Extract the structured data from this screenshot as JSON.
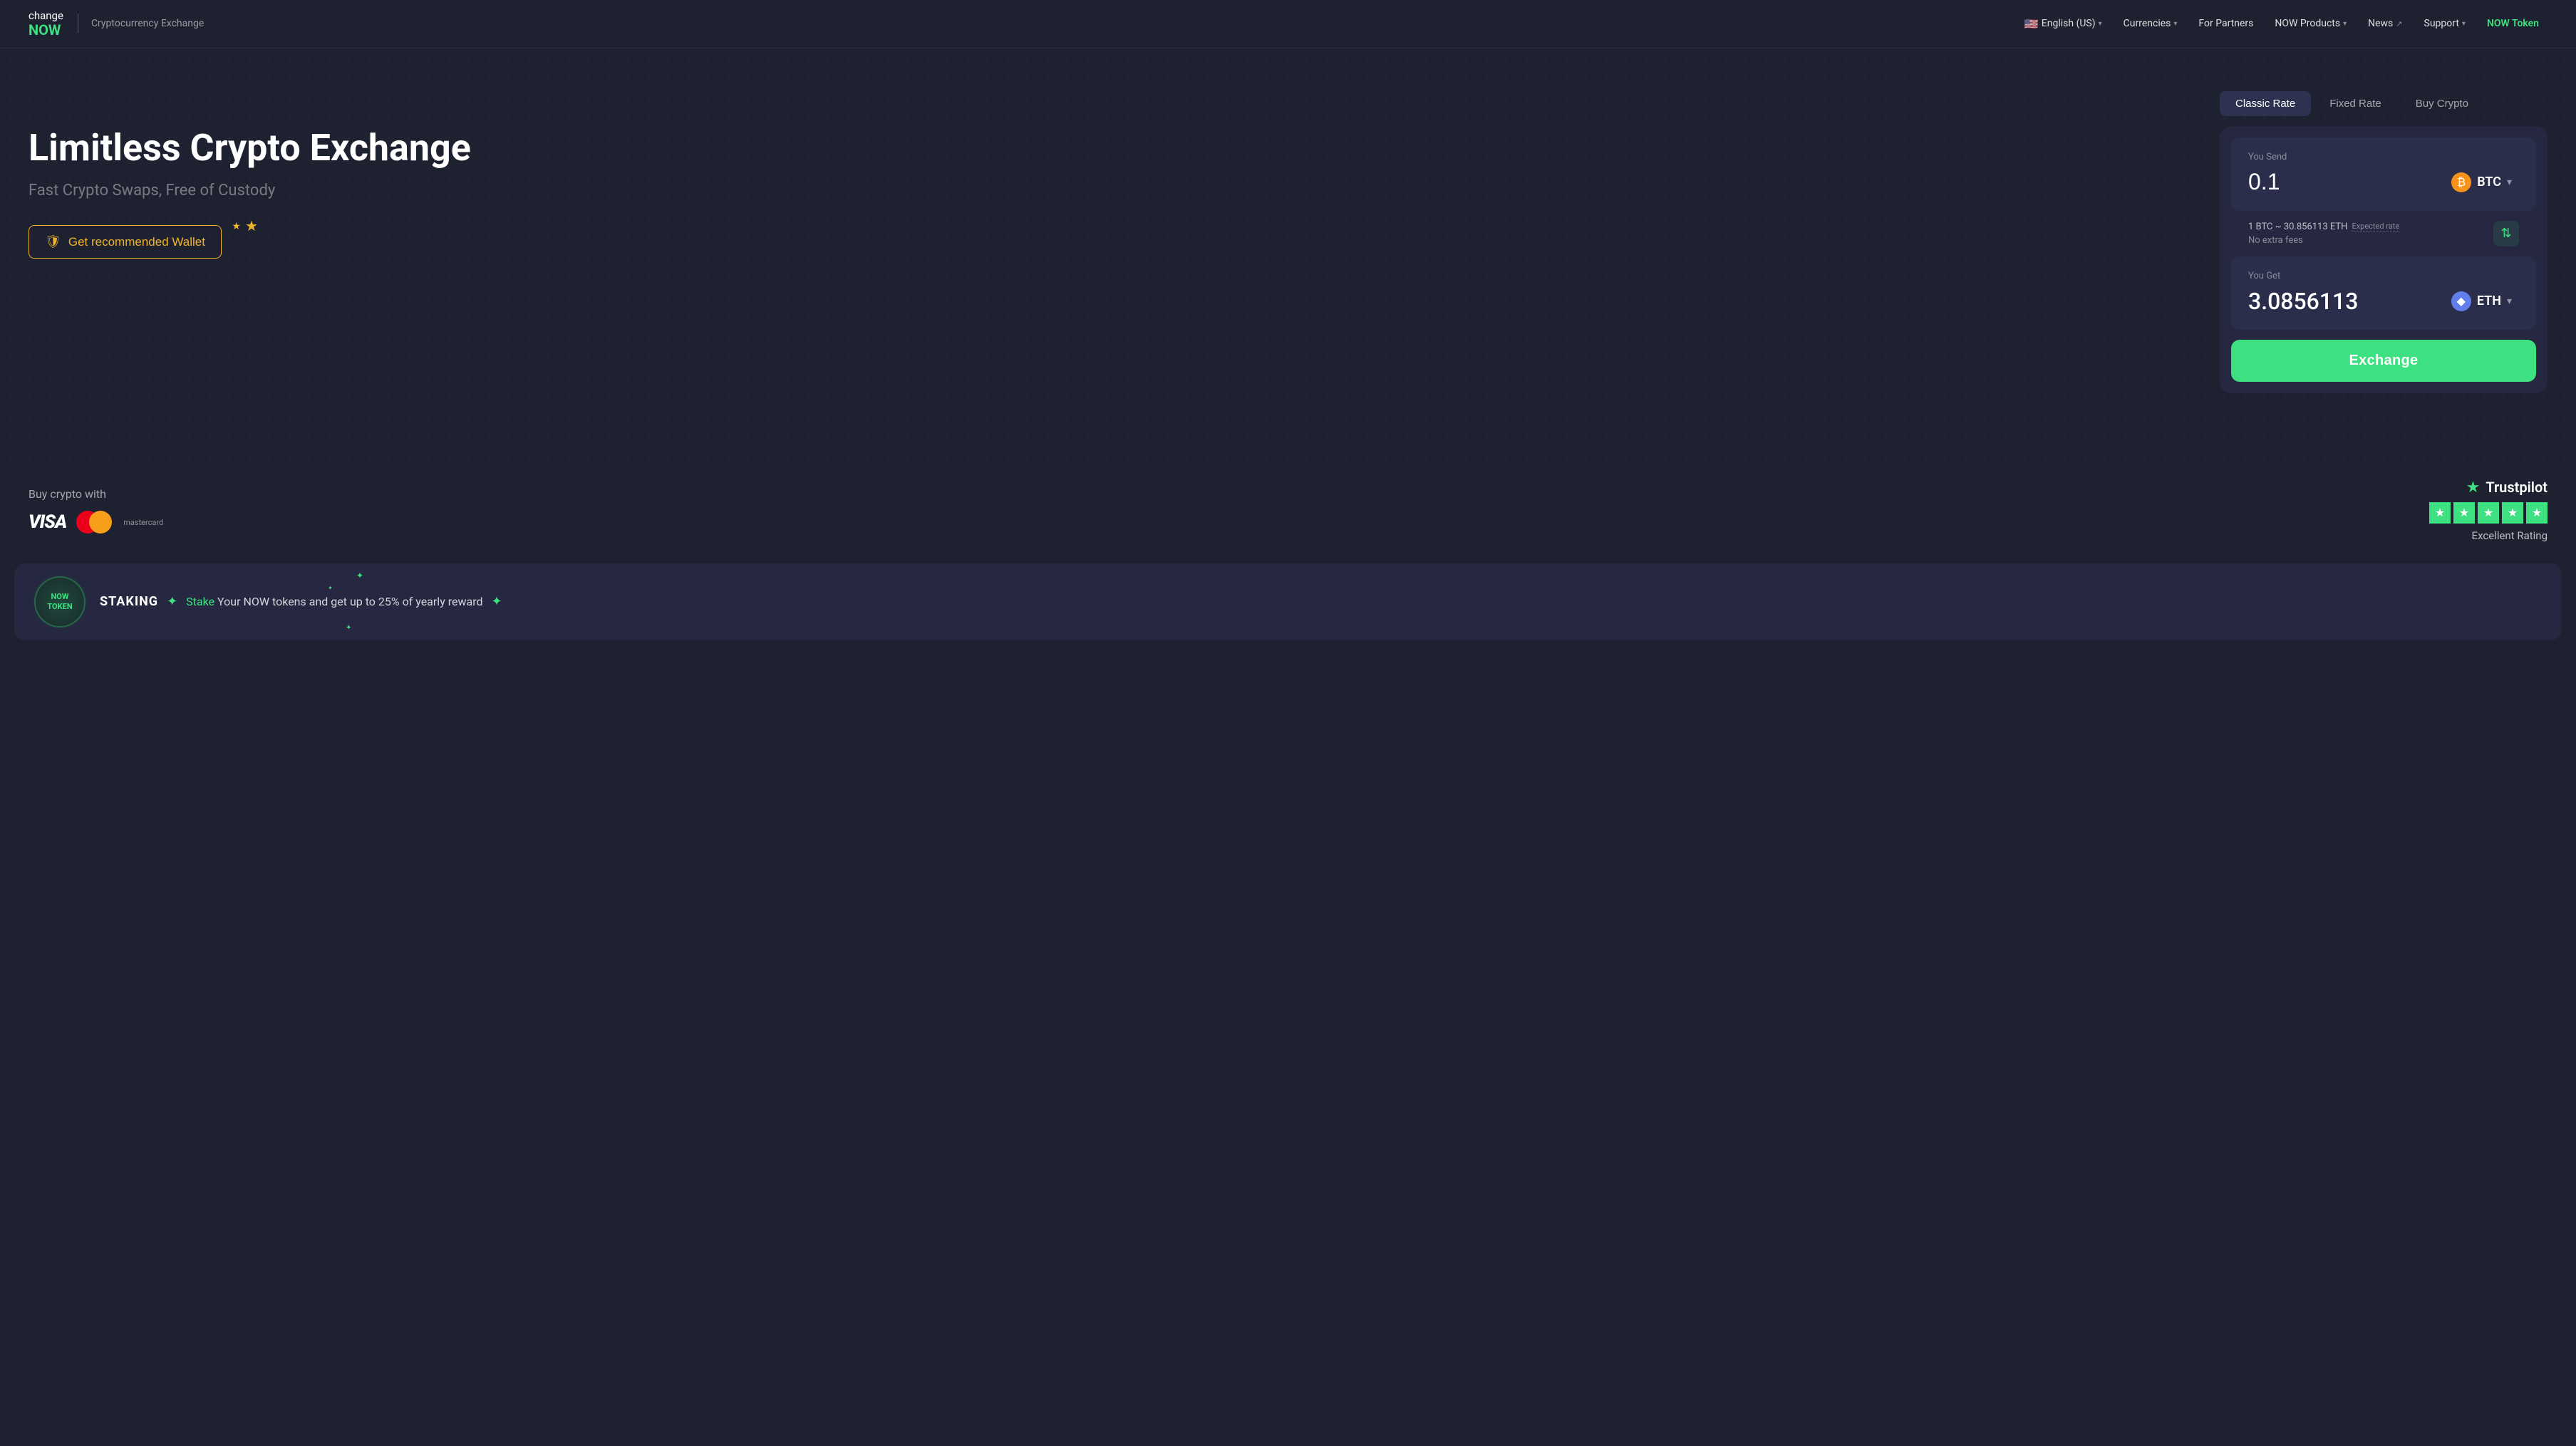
{
  "logo": {
    "change": "change",
    "now": "NOW"
  },
  "header": {
    "subtitle": "Cryptocurrency Exchange",
    "nav": [
      {
        "id": "language",
        "label": "English (US)",
        "hasChevron": true,
        "hasFlag": true
      },
      {
        "id": "currencies",
        "label": "Currencies",
        "hasChevron": true
      },
      {
        "id": "partners",
        "label": "For Partners",
        "hasChevron": false
      },
      {
        "id": "now-products",
        "label": "NOW Products",
        "hasChevron": true
      },
      {
        "id": "news",
        "label": "News",
        "hasExt": true
      },
      {
        "id": "support",
        "label": "Support",
        "hasChevron": true
      },
      {
        "id": "now-token",
        "label": "NOW Token",
        "isGreen": true
      }
    ]
  },
  "hero": {
    "title": "Limitless Crypto Exchange",
    "subtitle": "Fast Crypto Swaps, Free of Custody",
    "wallet_button": "Get recommended Wallet"
  },
  "exchange": {
    "tabs": [
      {
        "id": "classic",
        "label": "Classic Rate",
        "active": true
      },
      {
        "id": "fixed",
        "label": "Fixed Rate",
        "active": false
      },
      {
        "id": "buy",
        "label": "Buy Crypto",
        "active": false
      }
    ],
    "send_label": "You Send",
    "send_amount": "0.1",
    "send_currency": "BTC",
    "rate_line": "1 BTC ~ 30.856113 ETH",
    "expected_rate": "Expected rate",
    "no_fees": "No extra fees",
    "get_label": "You Get",
    "get_amount": "3.0856113",
    "get_currency": "ETH",
    "exchange_button": "Exchange"
  },
  "payment": {
    "label": "Buy crypto with",
    "visa": "VISA",
    "mastercard": "mastercard"
  },
  "trustpilot": {
    "name": "Trustpilot",
    "rating": "Excellent Rating",
    "stars": 5
  },
  "staking": {
    "badge_line1": "NOW",
    "badge_line2": "TOKEN",
    "label": "STAKING",
    "description_prefix": "Your NOW tokens and get up to 25% of yearly reward",
    "stake_link": "Stake"
  }
}
